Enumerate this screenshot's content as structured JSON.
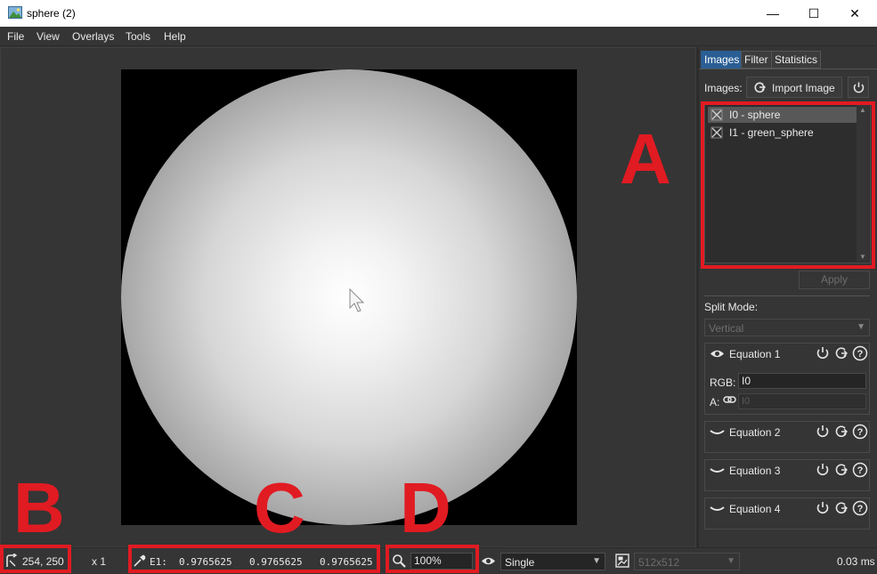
{
  "window": {
    "title": "sphere (2)",
    "minimize_glyph": "—",
    "maximize_glyph": "☐",
    "close_glyph": "✕"
  },
  "menu": [
    "File",
    "View",
    "Overlays",
    "Tools",
    "Help"
  ],
  "panel": {
    "tabs": [
      "Images",
      "Filter",
      "Statistics"
    ],
    "active_tab": "Images",
    "images_label": "Images:",
    "import_button": "Import Image",
    "image_list": [
      {
        "label": "I0 - sphere",
        "selected": true
      },
      {
        "label": "I1 - green_sphere",
        "selected": false
      }
    ],
    "apply_button": "Apply",
    "split_mode_label": "Split Mode:",
    "split_mode_value": "Vertical",
    "equations": [
      {
        "name": "Equation 1",
        "expanded": true,
        "rgb_label": "RGB:",
        "rgb_value": "I0",
        "a_label": "A:",
        "a_placeholder": "I0"
      },
      {
        "name": "Equation 2",
        "expanded": false
      },
      {
        "name": "Equation 3",
        "expanded": false
      },
      {
        "name": "Equation 4",
        "expanded": false
      }
    ]
  },
  "status": {
    "cursor_pos": "254, 250",
    "multiplier": "x 1",
    "pixel_label": "E1:",
    "pixel_values": [
      "0.9765625",
      "0.9765625",
      "0.9765625"
    ],
    "zoom": "100%",
    "display_mode": "Single",
    "resolution": "512x512",
    "frame_time": "0.03 ms"
  },
  "annotations": {
    "A": "A",
    "B": "B",
    "C": "C",
    "D": "D",
    "color": "#e11b22"
  },
  "colors": {
    "background": "#353535",
    "active_tab": "#2a5e94",
    "selection": "#585858"
  }
}
